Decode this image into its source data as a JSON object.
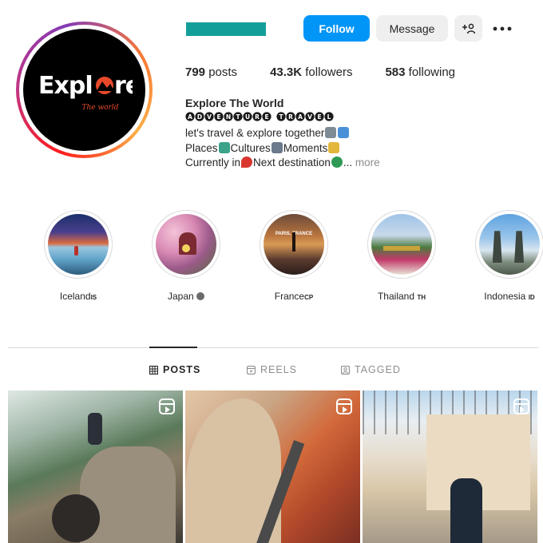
{
  "profile": {
    "avatar": {
      "logo_main": "Explore",
      "logo_sub": "The world"
    },
    "buttons": {
      "follow": "Follow",
      "message": "Message",
      "add_user_icon": "add-user-icon",
      "more_icon": "more-icon"
    },
    "stats": {
      "posts_count": "799",
      "posts_label": "posts",
      "followers_count": "43.3K",
      "followers_label": "followers",
      "following_count": "583",
      "following_label": "following"
    },
    "bio": {
      "name": "Explore The World",
      "tagline": "ADVENTURE TRAVEL",
      "line1": "let's travel & explore together",
      "line2_a": "Places",
      "line2_b": "Cultures",
      "line2_c": "Moments",
      "line3_a": "Currently in",
      "line3_b": "Next destination",
      "ellipsis": "...",
      "more": "more"
    }
  },
  "highlights": [
    {
      "label": "Iceland",
      "flag": "IS"
    },
    {
      "label": "Japan",
      "flag": ""
    },
    {
      "label": "France",
      "flag": "CP",
      "badge": "PARIS, FRANCE"
    },
    {
      "label": "Thailand",
      "flag": "TH"
    },
    {
      "label": "Indonesia",
      "flag": "ID"
    }
  ],
  "tabs": [
    {
      "label": "POSTS",
      "icon": "grid-icon",
      "active": true
    },
    {
      "label": "REELS",
      "icon": "reels-icon",
      "active": false
    },
    {
      "label": "TAGGED",
      "icon": "tagged-icon",
      "active": false
    }
  ],
  "colors": {
    "accent": "#0095f6",
    "username_redaction": "#149e9a"
  }
}
